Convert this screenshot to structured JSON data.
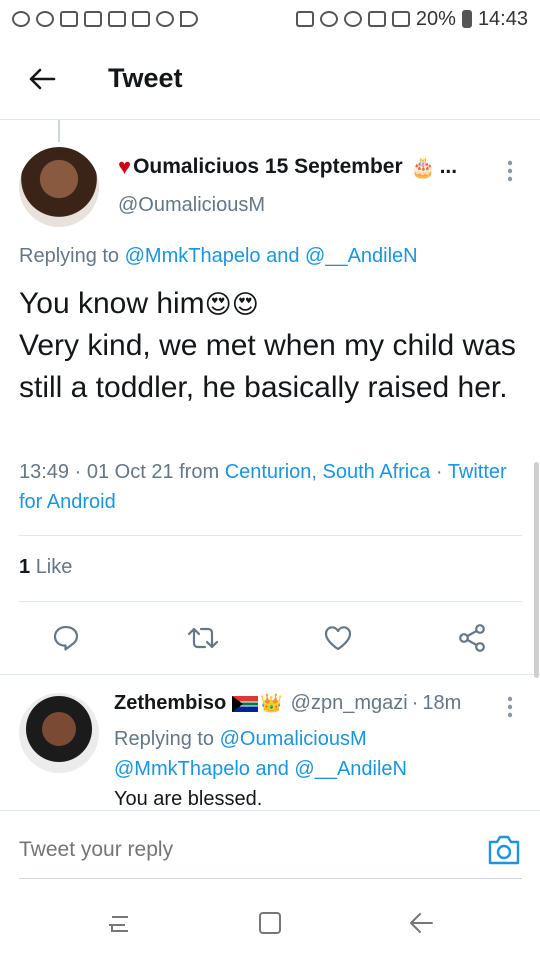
{
  "status_bar": {
    "battery": "20%",
    "time": "14:43"
  },
  "header": {
    "title": "Tweet"
  },
  "tweet": {
    "display_name": "Oumaliciuos 15 September",
    "name_truncation": "...",
    "handle": "@OumaliciousM",
    "replying_prefix": "Replying to",
    "replying_to_1": "@MmkThapelo",
    "replying_and": "and",
    "replying_to_2": "@__AndileN",
    "text_line1": "You know him",
    "text_emoji": "😍😍",
    "text_rest": "Very kind, we met when my child was still a toddler, he basically raised her.",
    "time": "13:49",
    "date": "01 Oct 21",
    "from_label": "from",
    "location": "Centurion, South Africa",
    "source": "Twitter for Android",
    "like_count": "1",
    "like_label": "Like"
  },
  "reply": {
    "display_name": "Zethembiso",
    "handle": "@zpn_mgazi",
    "age": "18m",
    "replying_prefix": "Replying to",
    "replying_to_1": "@OumaliciousM",
    "replying_to_2": "@MmkThapelo",
    "replying_and": "and",
    "replying_to_3": "@__AndileN",
    "text": "You are blessed."
  },
  "composer": {
    "placeholder": "Tweet your reply"
  },
  "colors": {
    "link": "#1b95e0",
    "secondary_text": "#657786",
    "icon": "#657786",
    "heart": "#d0021b"
  },
  "icons": {
    "back": "arrow-left-icon",
    "more": "more-vertical-icon",
    "reply": "reply-icon",
    "retweet": "retweet-icon",
    "like": "heart-outline-icon",
    "share": "share-icon",
    "camera": "camera-icon"
  }
}
